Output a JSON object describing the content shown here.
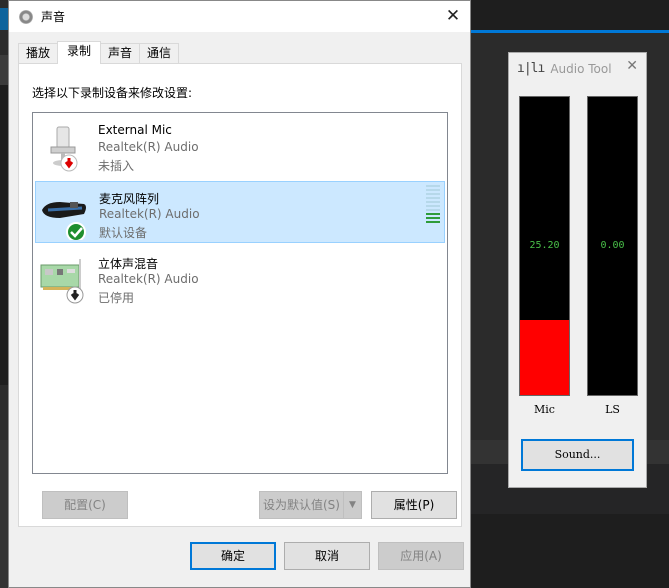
{
  "sound_dialog": {
    "title": "声音",
    "tabs": [
      {
        "label": "播放"
      },
      {
        "label": "录制"
      },
      {
        "label": "声音"
      },
      {
        "label": "通信"
      }
    ],
    "instructions": "选择以下录制设备来修改设置:",
    "devices": [
      {
        "name": "External Mic",
        "driver": "Realtek(R) Audio",
        "status": "未插入",
        "icon": "external-mic-icon",
        "badge": "unplugged"
      },
      {
        "name": "麦克风阵列",
        "driver": "Realtek(R) Audio",
        "status": "默认设备",
        "icon": "microphone-array-icon",
        "badge": "default",
        "selected": true,
        "level_fraction": 0.25
      },
      {
        "name": "立体声混音",
        "driver": "Realtek(R) Audio",
        "status": "已停用",
        "icon": "stereo-mix-icon",
        "badge": "disabled"
      }
    ],
    "buttons": {
      "configure": "配置(C)",
      "set_default": "设为默认值(S)",
      "properties": "属性(P)",
      "ok": "确定",
      "cancel": "取消",
      "apply": "应用(A)"
    }
  },
  "audio_tool": {
    "title": "Audio Tool",
    "meters": [
      {
        "label": "Mic",
        "value": "25.20",
        "level_fraction": 0.252
      },
      {
        "label": "LS",
        "value": "0.00",
        "level_fraction": 0
      }
    ],
    "sound_button": "Sound..."
  },
  "colors": {
    "selection_bg": "#cce8ff",
    "accent": "#0078d7",
    "meter_fill": "#ff0000",
    "meter_text": "#49c049",
    "level_on": "#2e9c3a"
  }
}
